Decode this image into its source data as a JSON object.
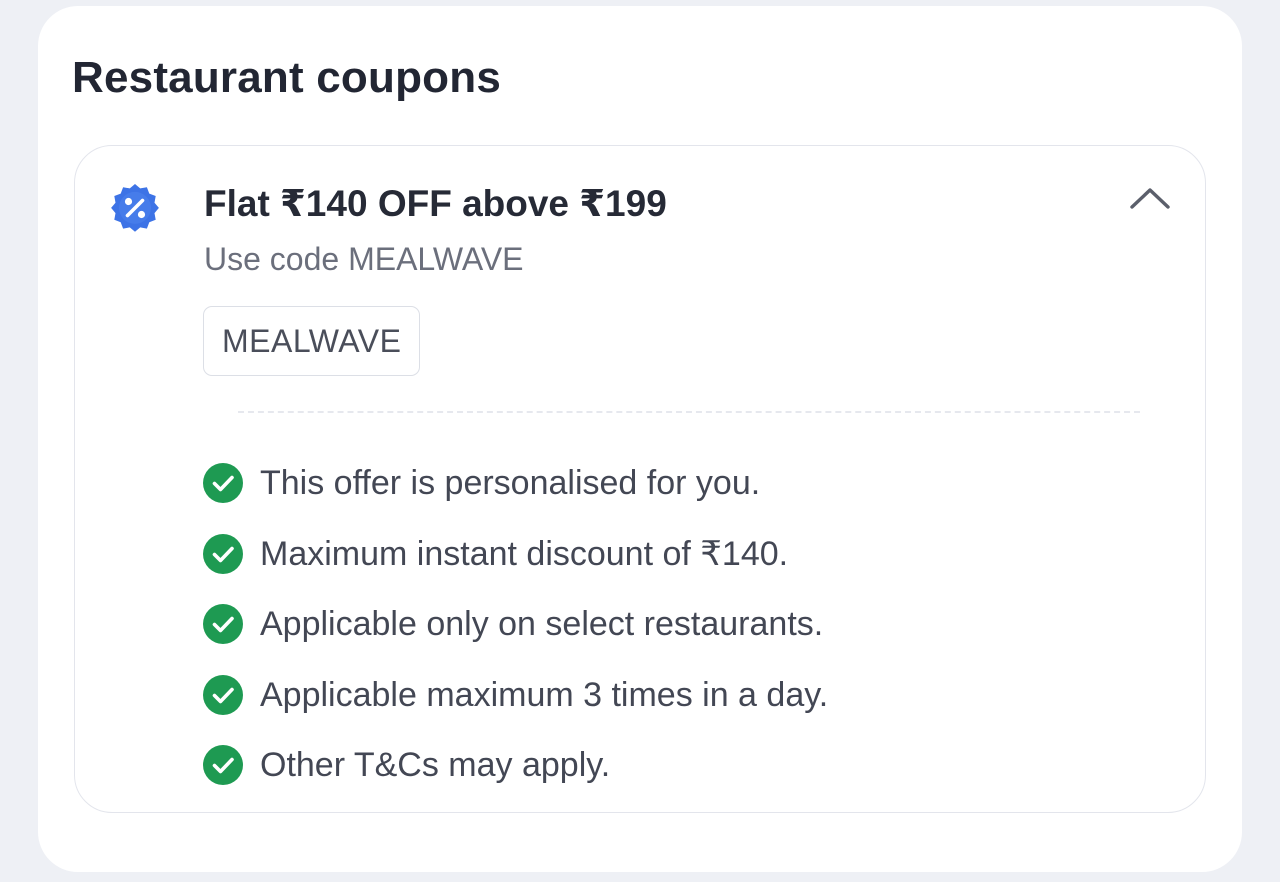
{
  "section": {
    "title": "Restaurant coupons"
  },
  "coupon": {
    "title": "Flat ₹140 OFF above ₹199",
    "subtitle": "Use code MEALWAVE",
    "code": "MEALWAVE",
    "badge_icon": "discount-badge-icon",
    "expand_icon": "chevron-up-icon",
    "accent_color": "#3d73e6",
    "terms": [
      "This offer is personalised for you.",
      "Maximum instant discount of ₹140.",
      "Applicable only on select restaurants.",
      "Applicable maximum 3 times in a day.",
      "Other T&Cs may apply."
    ],
    "term_icon": "check-circle-icon",
    "term_icon_color": "#1e9a52"
  }
}
